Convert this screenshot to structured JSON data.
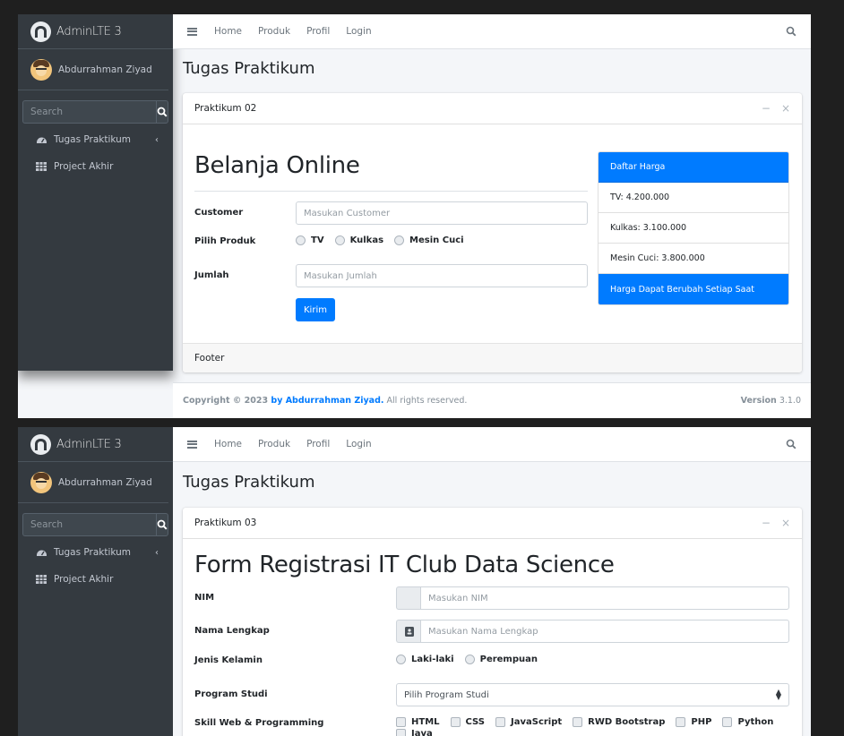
{
  "brand": {
    "name": "AdminLTE 3"
  },
  "user": {
    "name": "Abdurrahman Ziyad"
  },
  "sidebar": {
    "search_placeholder": "Search",
    "items": [
      {
        "label": "Tugas Praktikum",
        "icon": "tachometer-icon",
        "caret": "‹"
      },
      {
        "label": "Project Akhir",
        "icon": "table-icon"
      }
    ]
  },
  "topnav": {
    "items": [
      "Home",
      "Produk",
      "Profil",
      "Login"
    ]
  },
  "content": {
    "title": "Tugas Praktikum"
  },
  "screen1": {
    "card_title": "Praktikum 02",
    "card_tools": {
      "minimize": "−",
      "close": "×"
    },
    "heading": "Belanja Online",
    "form": {
      "customer_label": "Customer",
      "customer_placeholder": "Masukan Customer",
      "produk_label": "Pilih Produk",
      "produk_options": [
        "TV",
        "Kulkas",
        "Mesin Cuci"
      ],
      "jumlah_label": "Jumlah",
      "jumlah_placeholder": "Masukan Jumlah",
      "submit_label": "Kirim"
    },
    "price_list": {
      "header": "Daftar Harga",
      "items": [
        "TV: 4.200.000",
        "Kulkas: 3.100.000",
        "Mesin Cuci: 3.800.000"
      ],
      "footer": "Harga Dapat Berubah Setiap Saat"
    },
    "card_footer": "Footer",
    "main_footer": {
      "copyright": "Copyright © 2023 ",
      "author": "by Abdurrahman Ziyad.",
      "rights": " All rights reserved.",
      "version_label": "Version",
      "version_number": " 3.1.0"
    }
  },
  "screen2": {
    "card_title": "Praktikum 03",
    "card_tools": {
      "minimize": "−",
      "close": "×"
    },
    "heading": "Form Registrasi IT Club Data Science",
    "form": {
      "nim_label": "NIM",
      "nim_placeholder": "Masukan NIM",
      "nama_label": "Nama Lengkap",
      "nama_placeholder": "Masukan Nama Lengkap",
      "gender_label": "Jenis Kelamin",
      "gender_options": [
        "Laki-laki",
        "Perempuan"
      ],
      "prodi_label": "Program Studi",
      "prodi_selected": "Pilih Program Studi",
      "skill_label": "Skill Web & Programming",
      "skill_options": [
        "HTML",
        "CSS",
        "JavaScript",
        "RWD Bootstrap",
        "PHP",
        "Python",
        "Java"
      ]
    }
  },
  "colors": {
    "primary": "#007bff",
    "sidebar": "#343a40",
    "content_bg": "#f4f6f9"
  }
}
